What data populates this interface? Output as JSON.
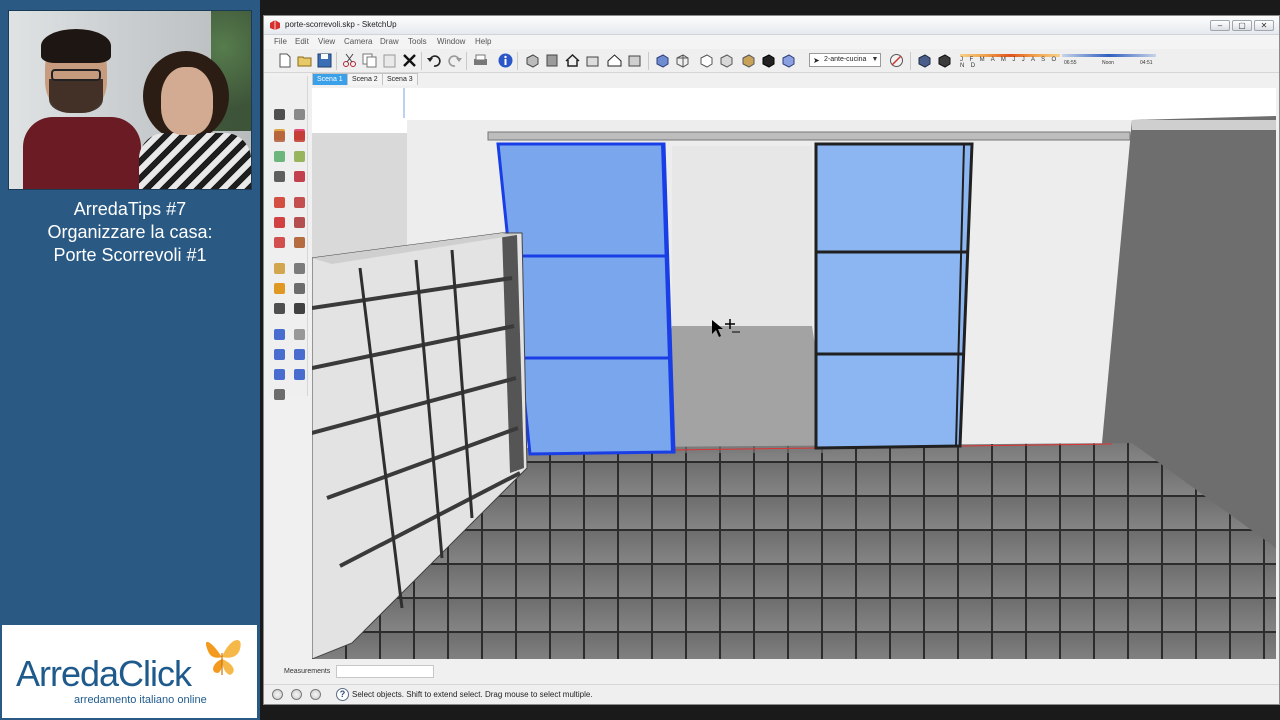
{
  "presenter_panel": {
    "title_lines": [
      "ArredaTips #7",
      "Organizzare la casa:",
      "Porte Scorrevoli #1"
    ],
    "logo": {
      "brand": "ArredaClick",
      "tagline": "arredamento italiano online",
      "brand_color": "#1f5a8c",
      "butterfly_color": "#f39a1e"
    },
    "background_color": "#2a5a84"
  },
  "window": {
    "title": "porte-scorrevoli.skp - SketchUp",
    "controls": {
      "minimize": "–",
      "maximize": "▢",
      "close": "✕"
    }
  },
  "menubar": {
    "items": [
      "File",
      "Edit",
      "View",
      "Camera",
      "Draw",
      "Tools",
      "Window",
      "Help"
    ]
  },
  "toolbar": {
    "style_select_value": "2-ante-cucina",
    "shadow_months": "J F M A M J J A S O N D",
    "shadow_time_start": "06:55",
    "shadow_time_mid": "Noon",
    "shadow_time_end": "04:51"
  },
  "scenes": {
    "tabs": [
      "Scena 1",
      "Scena 2",
      "Scena 3"
    ],
    "active": "Scena 1"
  },
  "left_tools": [
    "select-icon",
    "eraser-icon",
    "paint-bucket-icon",
    "erase-icon",
    "rectangle-icon",
    "line-icon",
    "circle-icon",
    "arc-icon",
    "polygon-icon",
    "freehand-icon",
    "move-icon",
    "push-pull-icon",
    "rotate-icon",
    "follow-me-icon",
    "scale-icon",
    "offset-icon",
    "tape-measure-icon",
    "dimension-icon",
    "protractor-icon",
    "text-icon",
    "axes-icon",
    "3d-text-icon",
    "orbit-icon",
    "pan-icon",
    "zoom-icon",
    "zoom-window-icon",
    "previous-view-icon",
    "next-view-icon",
    "zoom-extents-icon"
  ],
  "measurements": {
    "label": "Measurements",
    "value": ""
  },
  "status": {
    "message": "Select objects. Shift to extend select. Drag mouse to select multiple.",
    "help_glyph": "?"
  },
  "colors": {
    "selection_blue": "#1a3ee6",
    "glass_blue": "#8ab4f0",
    "floor_tile": "#7a7a7a",
    "wall": "#ededed"
  }
}
